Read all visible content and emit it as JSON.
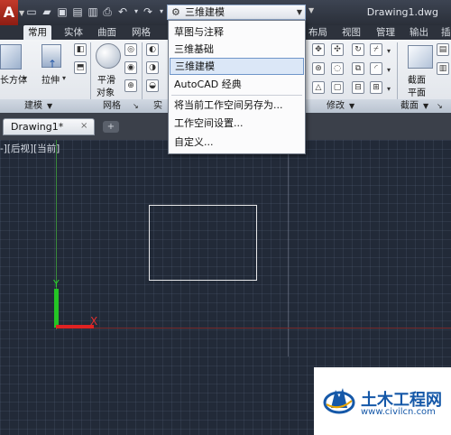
{
  "titlebar": {
    "app_logo": "A",
    "workspace_value": "三维建模",
    "document_title": "Drawing1.dwg",
    "quick_access_icons": [
      "new-icon",
      "open-icon",
      "save-icon",
      "save-as-icon",
      "print-icon",
      "undo-icon",
      "redo-icon"
    ]
  },
  "ribbon_tabs": [
    "常用",
    "实体",
    "曲面",
    "网格",
    "布局",
    "视图",
    "管理",
    "输出",
    "插"
  ],
  "ribbon": {
    "buttons": {
      "box": "长方体",
      "extrude": "拉伸",
      "smooth": "平滑",
      "smooth_obj": "对象",
      "section_1": "截面",
      "section_2": "平面"
    },
    "panels": {
      "modeling": "建模",
      "mesh": "网格",
      "solid_edit": "实",
      "modify": "修改",
      "section": "截面"
    }
  },
  "document_tab": {
    "label": "Drawing1*",
    "close": "×",
    "new_tab": "+"
  },
  "viewport": {
    "label": "-][后视][当前]",
    "ucs_x": "X",
    "ucs_y": "Y"
  },
  "workspace_menu": {
    "items": [
      "草图与注释",
      "三维基础",
      "三维建模",
      "AutoCAD 经典",
      "将当前工作空间另存为...",
      "工作空间设置...",
      "自定义..."
    ],
    "selected_index": 2
  },
  "watermark": {
    "name": "土木工程网",
    "url": "www.civilcn.com"
  },
  "colors": {
    "canvas": "#222a38",
    "x_axis": "#e02222",
    "y_axis": "#24c424",
    "menu_highlight": "#dbe7f7",
    "watermark_blue": "#1558a8"
  }
}
